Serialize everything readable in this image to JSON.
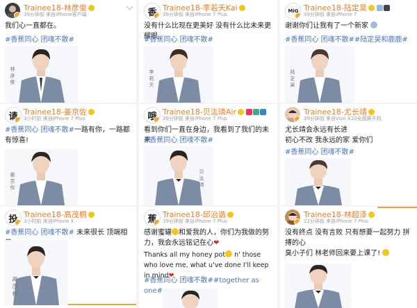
{
  "posts": [
    {
      "username": "Trainee18-林彦俊",
      "time": "39分钟前",
      "device": "来自iPhone客户端",
      "text": "我们心一直都在。",
      "hashtag": "#香蕉同心 团魂不散#",
      "signature": "林\n彦\n俊",
      "colors": {
        "avatar_bg": "#3a3a3a"
      }
    },
    {
      "username": "Trainee18-李若天Kai",
      "time": "39分钟前",
      "device": "来自iPhone 7 Plus",
      "avatar_char": "香",
      "text": "没有什么比现在更美好 没有什么比未来更耀眼",
      "hashtag": "#香蕉同心 团魂不散#",
      "signature": "李\n若\n天",
      "colors": {
        "avatar_bg": "#ffffff"
      }
    },
    {
      "username": "Trainee18-陆定昊",
      "time": "39分钟前",
      "device": "来自iPhone 7",
      "avatar_char": "MiG",
      "text": "谢谢你们让我有了一个新家",
      "hashtag": "#香蕉同心 团魂不散##陆定昊和鹿鹿#",
      "signature": "陆\n定\n昊",
      "colors": {
        "avatar_bg": "#ffffff"
      }
    },
    {
      "username": "Trainee18-姜京佐",
      "time": "3小时前",
      "device": "来自iPhone 7 Plus",
      "avatar_char": "请",
      "hashtag": "#香蕉同心 团魂不散#",
      "text_after_hashtag": "一路有你，一路都有惊喜!",
      "signature": "姜\n京\n佐",
      "colors": {
        "avatar_bg": "#ffffff"
      }
    },
    {
      "username": "Trainee18-贝汯璘Air",
      "time": "39分钟前",
      "device": "来自iPhone 7 Plus",
      "avatar_char": "哦",
      "text": "看到你们一直在身边，我看到了我们的未来",
      "hashtag": "#香蕉同心 团魂不散#",
      "signature": "贝\n汯\n璘",
      "colors": {
        "avatar_bg": "#ffffff"
      }
    },
    {
      "username": "Trainee18-尤长靖",
      "time": "39分钟前",
      "device": "来自vivo X20全面屏手机",
      "text": "尤长靖会永远有长进\n初心不改 我永远的家 爱你们",
      "hashtag": "#香蕉同心 团魂不散#",
      "colors": {
        "avatar_bg": "#e7c7b4"
      }
    },
    {
      "username": "Trainee18-高茂桐",
      "time": "3小时前",
      "device": "来自iPhone X",
      "avatar_char": "投",
      "hashtag": "#香蕉同心 团魂不散#",
      "text_after_hashtag": " 未来很长 顶端相见",
      "signature": "高\n茂\n桐",
      "colors": {
        "avatar_bg": "#ffffff"
      }
    },
    {
      "username": "Trainee18-邱治谐",
      "time": "39分钟前",
      "device": "来自iPhone 7 Plus",
      "avatar_char": "蕉",
      "text": "感谢蜜罐",
      "text_2": "和爱我的人，你们为我做的努力，我会永远铭记在心",
      "text_en_1": "Thanks all my honey pot",
      "text_en_2": " n' those who love me, what u've done I'll keep in mind",
      "hashtag": "#香蕉同心 团魂不散##together as one#",
      "colors": {
        "avatar_bg": "#ffffff"
      }
    },
    {
      "username": "Trainee18-林超泽",
      "time": "22分钟前",
      "device": "来自iPhone 7 Plus",
      "text": "没有终点 没有言败 只有想要一起努力 拼搏的心",
      "text_2": "臭小子们 林老师回来要上课了!",
      "colors": {
        "avatar_bg": "#c58b4f"
      }
    }
  ],
  "icons": {
    "verified": "verified-badge-icon",
    "chevron": "chevron-down-icon",
    "emoji": "smiley-emoji-icon",
    "heart": "heart-icon"
  },
  "colors": {
    "username": "#f07c20",
    "hashtag": "#4a77b8",
    "meta": "#9a9a9a",
    "blazer": "#7d8ca5",
    "orange_bar": "#f0a030"
  }
}
